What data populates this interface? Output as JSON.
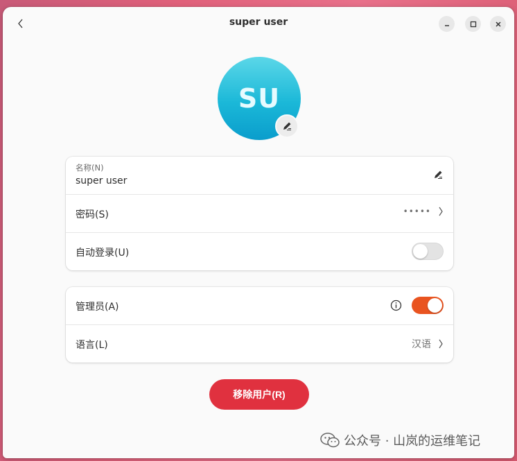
{
  "window": {
    "title": "super user"
  },
  "avatar": {
    "initials": "SU"
  },
  "account_card": {
    "name_label": "名称(N)",
    "name_value": "super user",
    "password_label": "密码(S)",
    "password_mask": "•••••",
    "autologin_label": "自动登录(U)",
    "autologin_enabled": false
  },
  "settings_card": {
    "admin_label": "管理员(A)",
    "admin_enabled": true,
    "language_label": "语言(L)",
    "language_value": "汉语"
  },
  "actions": {
    "remove_user_label": "移除用户(R)"
  },
  "watermark": {
    "text": "公众号 · 山岚的运维笔记"
  },
  "colors": {
    "accent": "#e95420",
    "destructive": "#e0313f",
    "avatar_top": "#5bd7e8",
    "avatar_bottom": "#0a9dcc"
  }
}
